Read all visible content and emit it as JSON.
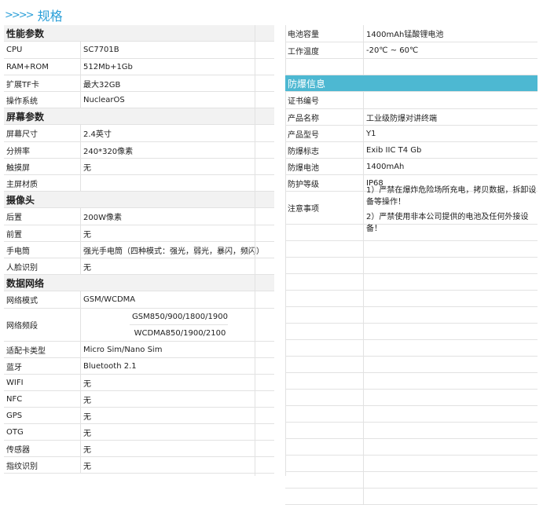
{
  "header": {
    "arrows": ">>>>",
    "title": "规格"
  },
  "left": {
    "performance": {
      "title": "性能参数",
      "rows": [
        {
          "label": "CPU",
          "value": "SC7701B"
        },
        {
          "label": "RAM+ROM",
          "value": "512Mb+1Gb"
        },
        {
          "label": "扩展TF卡",
          "value": "最大32GB"
        },
        {
          "label": "操作系统",
          "value": "NuclearOS"
        }
      ]
    },
    "screen": {
      "title": "屏幕参数",
      "rows": [
        {
          "label": "屏幕尺寸",
          "value": "2.4英寸"
        },
        {
          "label": "分辨率",
          "value": "240*320像素"
        },
        {
          "label": "触摸屏",
          "value": "无"
        },
        {
          "label": "主屏材质",
          "value": ""
        }
      ]
    },
    "camera": {
      "title": "摄像头",
      "rows": [
        {
          "label": "后置",
          "value": "200W像素"
        },
        {
          "label": "前置",
          "value": "无"
        },
        {
          "label": "手电筒",
          "value": "强光手电筒（四种模式：强光，弱光，暴闪，频闪）"
        },
        {
          "label": "人脸识别",
          "value": "无"
        }
      ]
    },
    "network": {
      "title": "数据网络",
      "mode": {
        "label": "网络模式",
        "value": "GSM/WCDMA"
      },
      "bands": {
        "label": "网络频段",
        "values": [
          "GSM850/900/1800/1900",
          "WCDMA850/1900/2100"
        ]
      },
      "rows": [
        {
          "label": "适配卡类型",
          "value": "Micro Sim/Nano Sim"
        },
        {
          "label": "蓝牙",
          "value": "Bluetooth 2.1"
        },
        {
          "label": "WIFI",
          "value": "无"
        },
        {
          "label": "NFC",
          "value": "无"
        },
        {
          "label": "GPS",
          "value": "无"
        },
        {
          "label": "OTG",
          "value": "无"
        },
        {
          "label": "传感器",
          "value": "无"
        },
        {
          "label": "指纹识别",
          "value": "无"
        }
      ]
    }
  },
  "right": {
    "battery": [
      {
        "label": "电池容量",
        "value": "1400mAh锰酸锂电池"
      },
      {
        "label": "工作温度",
        "value": "-20℃ ~ 60℃"
      }
    ],
    "explosion": {
      "title": "防爆信息",
      "rows": [
        {
          "label": "证书编号",
          "value": ""
        },
        {
          "label": "产品名称",
          "value": "工业级防爆对讲终端"
        },
        {
          "label": "产品型号",
          "value": "Y1"
        },
        {
          "label": "防爆标志",
          "value": "Exib IIC T4 Gb"
        },
        {
          "label": "防爆电池",
          "value": "1400mAh"
        },
        {
          "label": "防护等级",
          "value": "IP68"
        }
      ],
      "notes_label": "注意事项",
      "notes": [
        "1）严禁在爆炸危险场所充电，拷贝数据，拆卸设备等操作！",
        "2）严禁使用非本公司提供的电池及任何外接设备！"
      ]
    }
  }
}
